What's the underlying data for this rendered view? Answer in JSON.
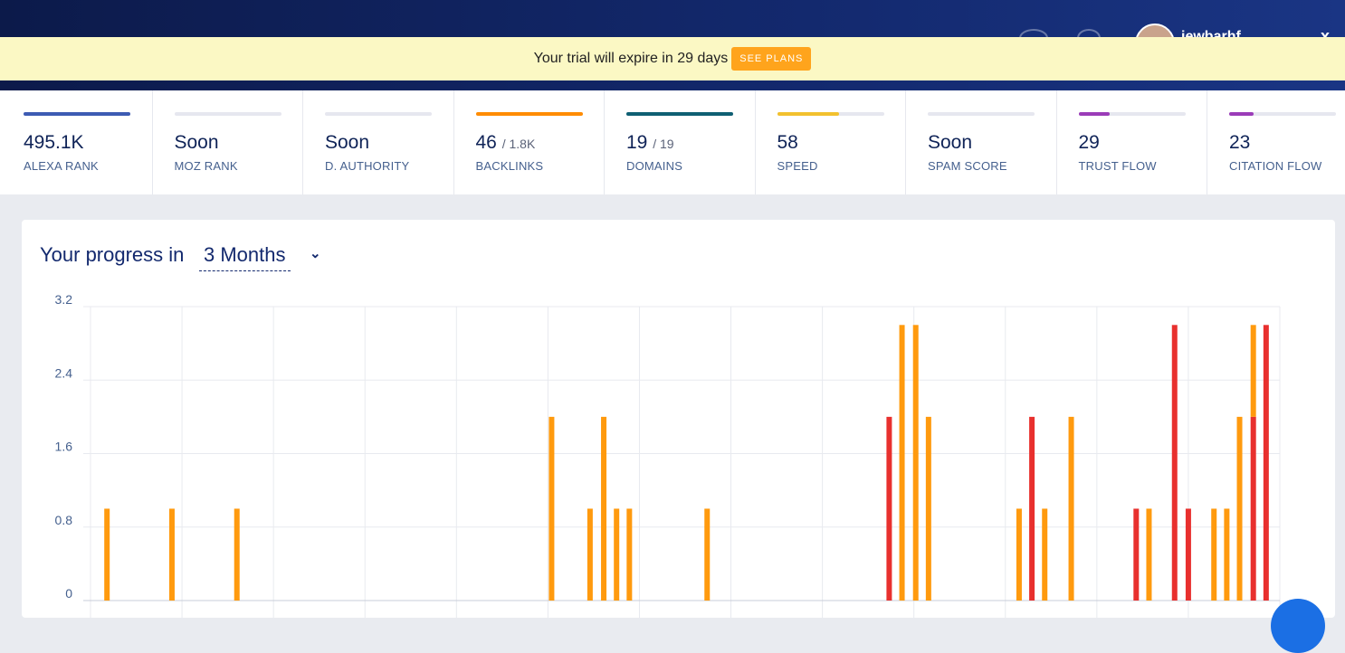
{
  "topbar": {
    "username": "jewbarhf",
    "close_label": "x"
  },
  "banner": {
    "text": "Your trial will expire in 29 days",
    "button": "SEE PLANS"
  },
  "metrics": [
    {
      "value": "495.1K",
      "sub": "",
      "label": "ALEXA RANK",
      "bar_color": "#3d5bb3",
      "fill": 1.0
    },
    {
      "value": "Soon",
      "sub": "",
      "label": "MOZ RANK",
      "bar_color": "#e6e7ef",
      "fill": 0
    },
    {
      "value": "Soon",
      "sub": "",
      "label": "D. AUTHORITY",
      "bar_color": "#e6e7ef",
      "fill": 0
    },
    {
      "value": "46",
      "sub": "/ 1.8K",
      "label": "BACKLINKS",
      "bar_color": "#ff8c00",
      "fill": 1.0
    },
    {
      "value": "19",
      "sub": "/ 19",
      "label": "DOMAINS",
      "bar_color": "#0f5f73",
      "fill": 1.0
    },
    {
      "value": "58",
      "sub": "",
      "label": "SPEED",
      "bar_color": "#f2c12e",
      "fill": 0.58
    },
    {
      "value": "Soon",
      "sub": "",
      "label": "SPAM SCORE",
      "bar_color": "#e6e7ef",
      "fill": 0
    },
    {
      "value": "29",
      "sub": "",
      "label": "TRUST FLOW",
      "bar_color": "#9b3cb8",
      "fill": 0.29
    },
    {
      "value": "23",
      "sub": "",
      "label": "CITATION FLOW",
      "bar_color": "#9b3cb8",
      "fill": 0.23
    }
  ],
  "progress": {
    "title": "Your progress in",
    "range": "3 Months"
  },
  "chart_data": {
    "type": "bar",
    "ylim": [
      0,
      3.2
    ],
    "yticks": [
      "3.2",
      "2.4",
      "1.6",
      "0.8",
      "0"
    ],
    "grid": true,
    "x_range": [
      0,
      13
    ],
    "colors": {
      "orange": "#ff9a0e",
      "red": "#e8302e"
    },
    "bars": [
      {
        "x": 0.18,
        "values": [
          {
            "c": "orange",
            "v": 1.0
          }
        ]
      },
      {
        "x": 0.89,
        "values": [
          {
            "c": "orange",
            "v": 1.0
          }
        ]
      },
      {
        "x": 1.6,
        "values": [
          {
            "c": "orange",
            "v": 1.0
          }
        ]
      },
      {
        "x": 5.04,
        "values": [
          {
            "c": "orange",
            "v": 2.0
          }
        ]
      },
      {
        "x": 5.46,
        "values": [
          {
            "c": "orange",
            "v": 1.0
          }
        ]
      },
      {
        "x": 5.61,
        "values": [
          {
            "c": "orange",
            "v": 2.0
          }
        ]
      },
      {
        "x": 5.75,
        "values": [
          {
            "c": "orange",
            "v": 1.0
          }
        ]
      },
      {
        "x": 5.89,
        "values": [
          {
            "c": "orange",
            "v": 1.0
          }
        ]
      },
      {
        "x": 6.74,
        "values": [
          {
            "c": "orange",
            "v": 1.0
          }
        ]
      },
      {
        "x": 8.73,
        "values": [
          {
            "c": "red",
            "v": 2.0
          }
        ]
      },
      {
        "x": 8.87,
        "values": [
          {
            "c": "orange",
            "v": 3.0
          }
        ]
      },
      {
        "x": 9.02,
        "values": [
          {
            "c": "orange",
            "v": 3.0
          }
        ]
      },
      {
        "x": 9.16,
        "values": [
          {
            "c": "orange",
            "v": 2.0
          }
        ]
      },
      {
        "x": 10.15,
        "values": [
          {
            "c": "orange",
            "v": 1.0
          }
        ]
      },
      {
        "x": 10.29,
        "values": [
          {
            "c": "red",
            "v": 2.0
          }
        ]
      },
      {
        "x": 10.43,
        "values": [
          {
            "c": "orange",
            "v": 1.0
          }
        ]
      },
      {
        "x": 10.72,
        "values": [
          {
            "c": "orange",
            "v": 2.0
          }
        ]
      },
      {
        "x": 11.43,
        "values": [
          {
            "c": "red",
            "v": 1.0
          }
        ]
      },
      {
        "x": 11.57,
        "values": [
          {
            "c": "orange",
            "v": 1.0
          }
        ]
      },
      {
        "x": 11.85,
        "values": [
          {
            "c": "red",
            "v": 3.0
          }
        ]
      },
      {
        "x": 12.0,
        "values": [
          {
            "c": "red",
            "v": 1.0
          }
        ]
      },
      {
        "x": 12.28,
        "values": [
          {
            "c": "orange",
            "v": 1.0
          }
        ]
      },
      {
        "x": 12.42,
        "values": [
          {
            "c": "orange",
            "v": 1.0
          }
        ]
      },
      {
        "x": 12.56,
        "values": [
          {
            "c": "orange",
            "v": 2.0
          }
        ]
      },
      {
        "x": 12.71,
        "values": [
          {
            "c": "red",
            "v": 2.0
          },
          {
            "c": "orange",
            "v": 1.0
          }
        ]
      },
      {
        "x": 12.85,
        "values": [
          {
            "c": "red",
            "v": 3.0
          }
        ]
      }
    ]
  }
}
